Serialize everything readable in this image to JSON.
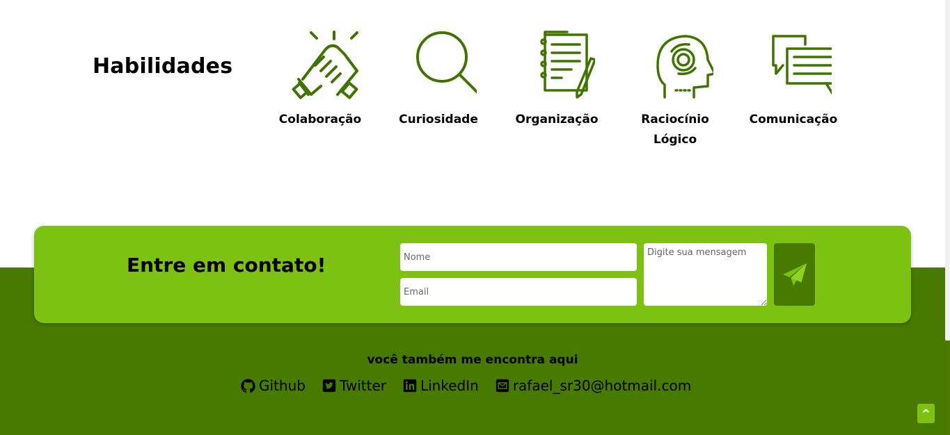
{
  "skills": {
    "title": "Habilidades",
    "items": [
      {
        "label": "Colaboração",
        "icon": "handshake-icon"
      },
      {
        "label": "Curiosidade",
        "icon": "magnifier-icon"
      },
      {
        "label": "Organização",
        "icon": "notepad-pencil-icon"
      },
      {
        "label": "Raciocínio Lógico",
        "icon": "head-gear-icon"
      },
      {
        "label": "Comunicação",
        "icon": "chat-bubbles-icon"
      }
    ]
  },
  "contact": {
    "title": "Entre em contato!",
    "name_placeholder": "Nome",
    "email_placeholder": "Email",
    "message_placeholder": "Digite sua mensagem",
    "send_icon": "paper-plane-icon"
  },
  "footer": {
    "title": "você também me encontra aqui",
    "links": [
      {
        "label": "Github",
        "icon": "github-icon"
      },
      {
        "label": "Twitter",
        "icon": "twitter-icon"
      },
      {
        "label": "LinkedIn",
        "icon": "linkedin-icon"
      },
      {
        "label": "rafael_sr30@hotmail.com",
        "icon": "envelope-icon"
      }
    ]
  },
  "back_to_top": {
    "label": "^"
  },
  "colors": {
    "accent_light": "#7dc213",
    "accent_dark": "#497a00",
    "icon_green": "#3f7400"
  }
}
